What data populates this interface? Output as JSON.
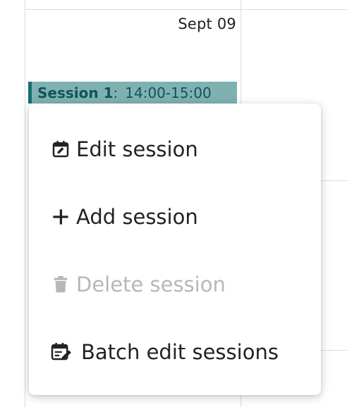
{
  "calendar": {
    "date_label": "Sept 09",
    "event": {
      "name": "Session 1",
      "separator": ":",
      "time": "14:00-15:00",
      "color": "#7fb1b3",
      "accent": "#126f72"
    }
  },
  "context_menu": {
    "items": [
      {
        "label": "Edit session",
        "icon": "calendar-edit-icon",
        "enabled": true
      },
      {
        "label": "Add session",
        "icon": "plus-icon",
        "enabled": true
      },
      {
        "label": "Delete session",
        "icon": "trash-icon",
        "enabled": false
      },
      {
        "label": "Batch edit sessions",
        "icon": "batch-edit-icon",
        "enabled": true
      }
    ]
  }
}
